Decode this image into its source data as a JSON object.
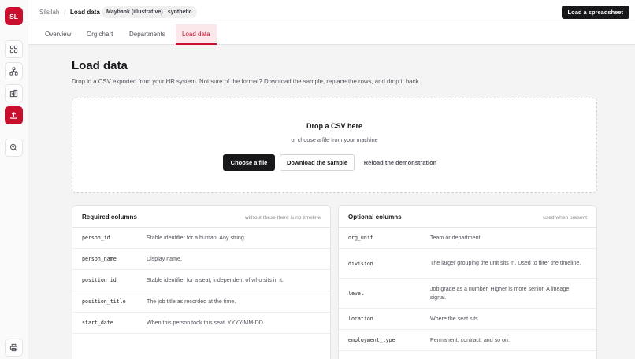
{
  "app": {
    "logo_text": "SL"
  },
  "rail": {
    "items": [
      {
        "icon": "grid-icon",
        "label": "Overview"
      },
      {
        "icon": "org-chart-icon",
        "label": "Org chart"
      },
      {
        "icon": "buildings-icon",
        "label": "Departments"
      },
      {
        "icon": "upload-icon",
        "label": "Load data",
        "active": true
      },
      {
        "icon": "search-zoom-icon",
        "label": "Search"
      }
    ],
    "bottom": {
      "icon": "print-icon"
    }
  },
  "topbar": {
    "breadcrumb_root": "Silsilah",
    "breadcrumb_sep": "/",
    "breadcrumb_current": "Load data",
    "dataset_badge": "Maybank (illustrative) · synthetic",
    "cta_label": "Load a spreadsheet"
  },
  "tabs": [
    "Overview",
    "Org chart",
    "Departments",
    "Load data"
  ],
  "page": {
    "title": "Load data",
    "description": "Drop in a CSV exported from your HR system. Not sure of the format? Download the sample, replace the rows, and drop it back."
  },
  "dropzone": {
    "title": "Drop a CSV here",
    "subtitle": "or choose a file from your machine",
    "choose_label": "Choose a file",
    "sample_label": "Download the sample",
    "reload_label": "Reload the demonstration"
  },
  "required": {
    "title": "Required columns",
    "note": "without these there is no timeline",
    "rows": [
      {
        "key": "person_id",
        "desc": "Stable identifier for a human. Any string."
      },
      {
        "key": "person_name",
        "desc": "Display name."
      },
      {
        "key": "position_id",
        "desc": "Stable identifier for a seat, independent of who sits in it."
      },
      {
        "key": "position_title",
        "desc": "The job title as recorded at the time."
      },
      {
        "key": "start_date",
        "desc": "When this person took this seat. YYYY-MM-DD."
      }
    ]
  },
  "optional": {
    "title": "Optional columns",
    "note": "used when present",
    "rows": [
      {
        "key": "org_unit",
        "desc": "Team or department."
      },
      {
        "key": "division",
        "desc": "The larger grouping the unit sits in. Used to filter the timeline."
      },
      {
        "key": "level",
        "desc": "Job grade as a number. Higher is more senior. A lineage signal."
      },
      {
        "key": "location",
        "desc": "Where the seat sits."
      },
      {
        "key": "employment_type",
        "desc": "Permanent, contract, and so on."
      }
    ]
  },
  "colors": {
    "accent": "#c8102e",
    "dark": "#18181b"
  }
}
